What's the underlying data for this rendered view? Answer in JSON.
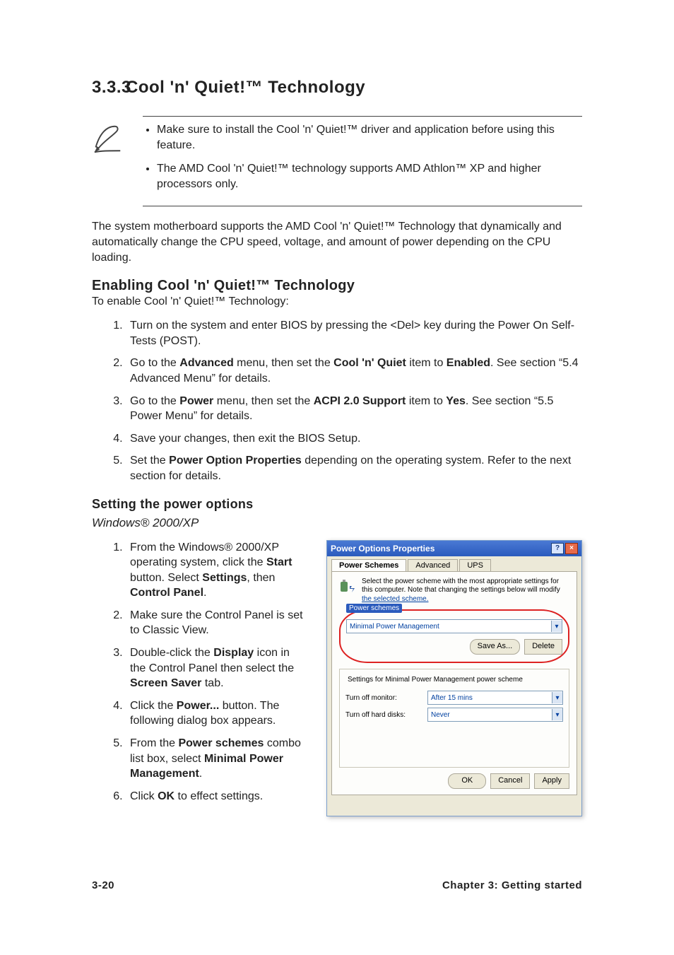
{
  "h1_num": "3.3.3",
  "h1_title": "Cool 'n' Quiet!™ Technology",
  "notes": [
    "Make sure to install the Cool 'n' Quiet!™ driver and application before using this feature.",
    "The AMD Cool 'n' Quiet!™ technology supports AMD Athlon™ XP and higher processors only."
  ],
  "intro": "The system motherboard supports the AMD Cool 'n' Quiet!™ Technology that dynamically and automatically change the CPU speed, voltage, and amount of power depending on the CPU loading.",
  "h2": "Enabling Cool 'n' Quiet!™ Technology",
  "lead": "To enable Cool 'n' Quiet!™ Technology:",
  "steps": [
    {
      "pre": "Turn on the system and enter BIOS by pressing the <Del> key during the Power On Self-Tests (POST)."
    },
    {
      "pre": "Go to the ",
      "b1": "Advanced",
      "mid1": " menu, then set the ",
      "b2": "Cool 'n' Quiet",
      "mid2": " item to ",
      "b3": "Enabled",
      "post": ". See section “5.4 Advanced Menu” for details."
    },
    {
      "pre": "Go to the ",
      "b1": "Power",
      "mid1": " menu, then set the ",
      "b2": "ACPI 2.0 Support",
      "mid2": " item to ",
      "b3": "Yes",
      "post": ". See section “5.5 Power Menu” for details."
    },
    {
      "pre": "Save your changes, then exit the BIOS Setup."
    },
    {
      "pre": "Set the ",
      "b1": "Power Option Properties",
      "post": " depending on the operating system. Refer to the next section for details."
    }
  ],
  "h3": "Setting the power options",
  "os": "Windows® 2000/XP",
  "steps2": [
    {
      "pre": "From the Windows® 2000/XP operating system, click the ",
      "b1": "Start",
      "mid1": " button. Select ",
      "b2": "Settings",
      "mid2": ", then ",
      "b3": "Control Panel",
      "post": "."
    },
    {
      "pre": "Make sure the Control Panel is set to Classic View."
    },
    {
      "pre": "Double-click the ",
      "b1": "Display",
      "mid1": " icon in the Control Panel then select the ",
      "b2": "Screen Saver",
      "post": " tab."
    },
    {
      "pre": "Click the ",
      "b1": "Power...",
      "post": " button. The following dialog box appears."
    },
    {
      "pre": "From the ",
      "b1": "Power schemes",
      "mid1": " combo list box, select ",
      "b2": "Minimal Power Management",
      "post": "."
    },
    {
      "pre": "Click ",
      "b1": "OK",
      "post": " to effect settings."
    }
  ],
  "dlg": {
    "title": "Power Options Properties",
    "tabs": [
      "Power Schemes",
      "Advanced",
      "UPS"
    ],
    "hint": "Select the power scheme with the most appropriate settings for this computer. Note that changing the settings below will modify ",
    "hint_u": "the selected scheme.",
    "schemes_legend": "Power schemes",
    "scheme_value": "Minimal Power Management",
    "save_as": "Save As...",
    "delete": "Delete",
    "settings_legend": "Settings for Minimal Power Management power scheme",
    "monitor_lbl": "Turn off monitor:",
    "monitor_val": "After 15 mins",
    "hdd_lbl": "Turn off hard disks:",
    "hdd_val": "Never",
    "ok": "OK",
    "cancel": "Cancel",
    "apply": "Apply"
  },
  "footer_left": "3-20",
  "footer_right": "Chapter 3: Getting started"
}
